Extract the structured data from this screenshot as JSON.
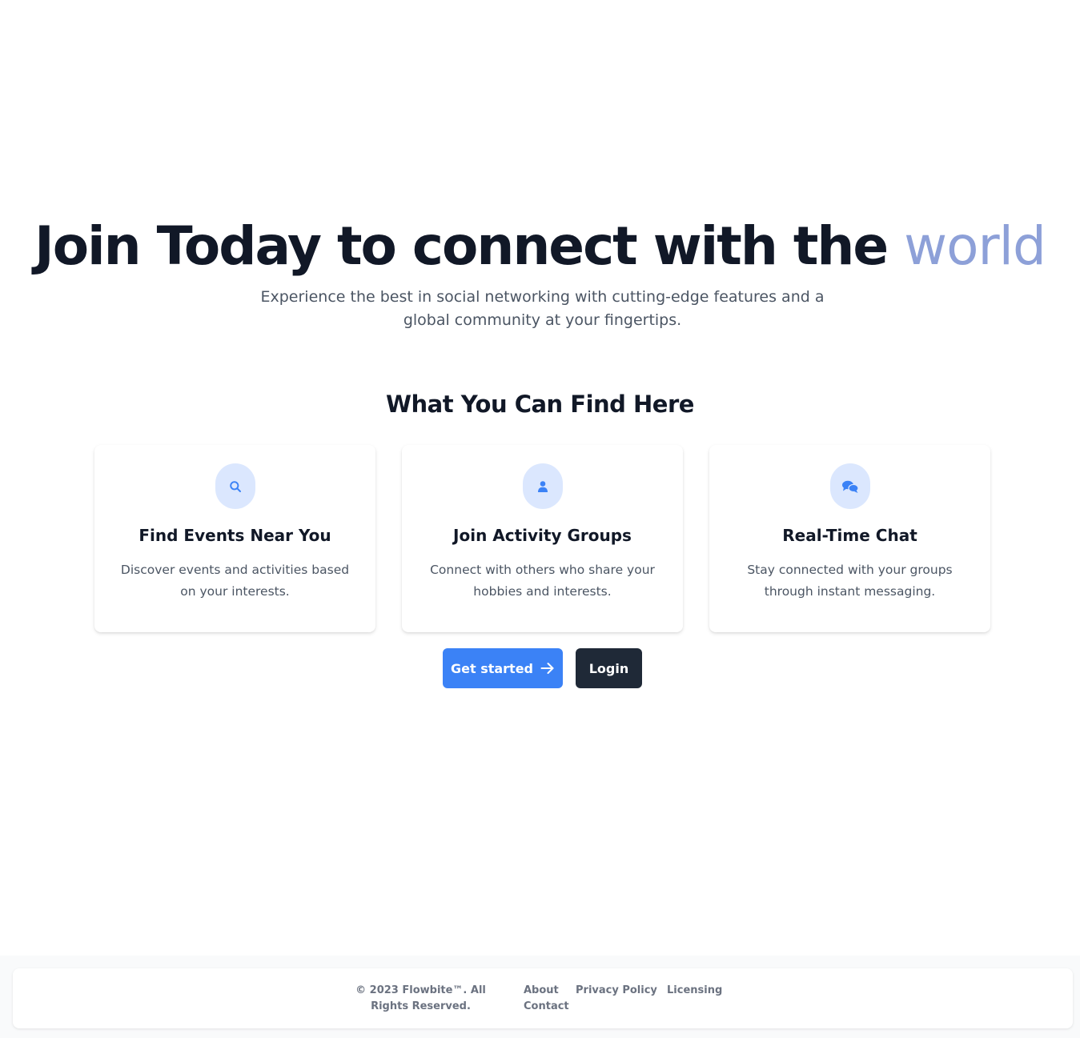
{
  "hero": {
    "title_main": "Join Today to connect with the ",
    "title_accent": "world",
    "subtitle": "Experience the best in social networking with cutting-edge features and a global community at your fingertips."
  },
  "features": {
    "heading": "What You Can Find Here",
    "cards": [
      {
        "icon": "search-icon",
        "title": "Find Events Near You",
        "description": "Discover events and activities based on your interests."
      },
      {
        "icon": "user-icon",
        "title": "Join Activity Groups",
        "description": "Connect with others who share your hobbies and interests."
      },
      {
        "icon": "chat-icon",
        "title": "Real-Time Chat",
        "description": "Stay connected with your groups through instant messaging."
      }
    ]
  },
  "actions": {
    "get_started_label": "Get started",
    "login_label": "Login"
  },
  "footer": {
    "copyright": "© 2023 Flowbite™. All Rights Reserved.",
    "links": [
      "About",
      "Privacy Policy",
      "Licensing",
      "Contact"
    ]
  },
  "colors": {
    "accent_blue": "#3b82f6",
    "dark_button": "#1f2937",
    "title_accent": "#8da0d8",
    "icon_bg": "#dbe7fe"
  }
}
